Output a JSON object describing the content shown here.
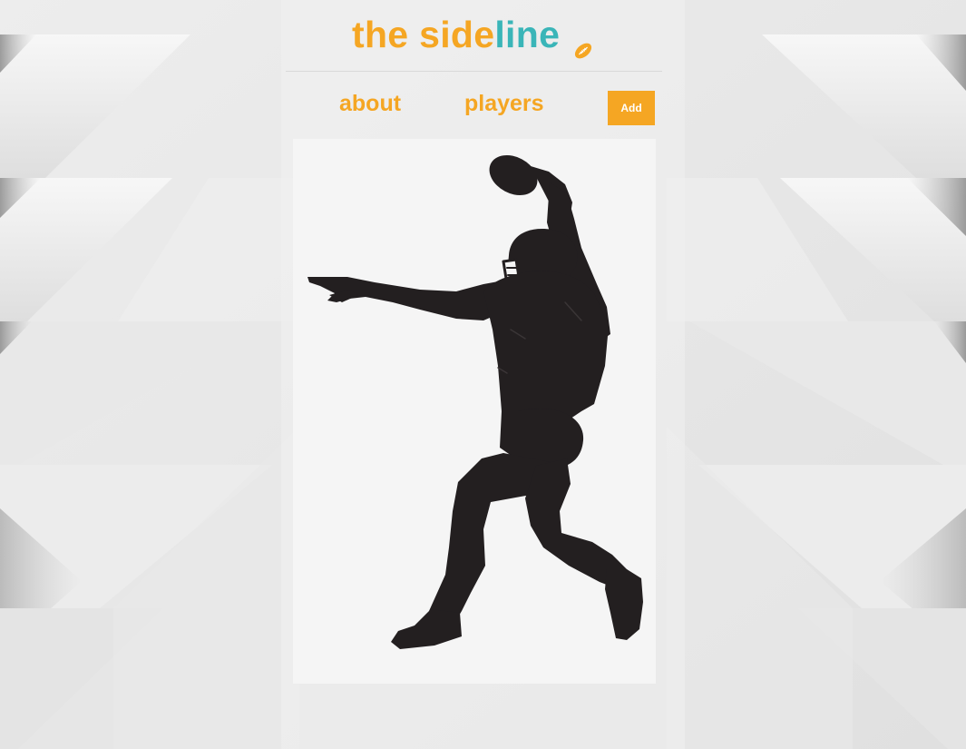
{
  "header": {
    "logo": {
      "part_a": "the side",
      "part_b": "line",
      "icon": "football-icon"
    }
  },
  "nav": {
    "about_label": "about",
    "players_label": "players",
    "add_button_label": "Add"
  },
  "main": {
    "image": {
      "icon": "football-player-silhouette",
      "alt": "Quarterback throwing a football"
    }
  },
  "colors": {
    "brand_orange": "#f5a623",
    "brand_teal": "#3ab5b8",
    "silhouette": "#231f20",
    "card_background": "#f5f5f5"
  }
}
